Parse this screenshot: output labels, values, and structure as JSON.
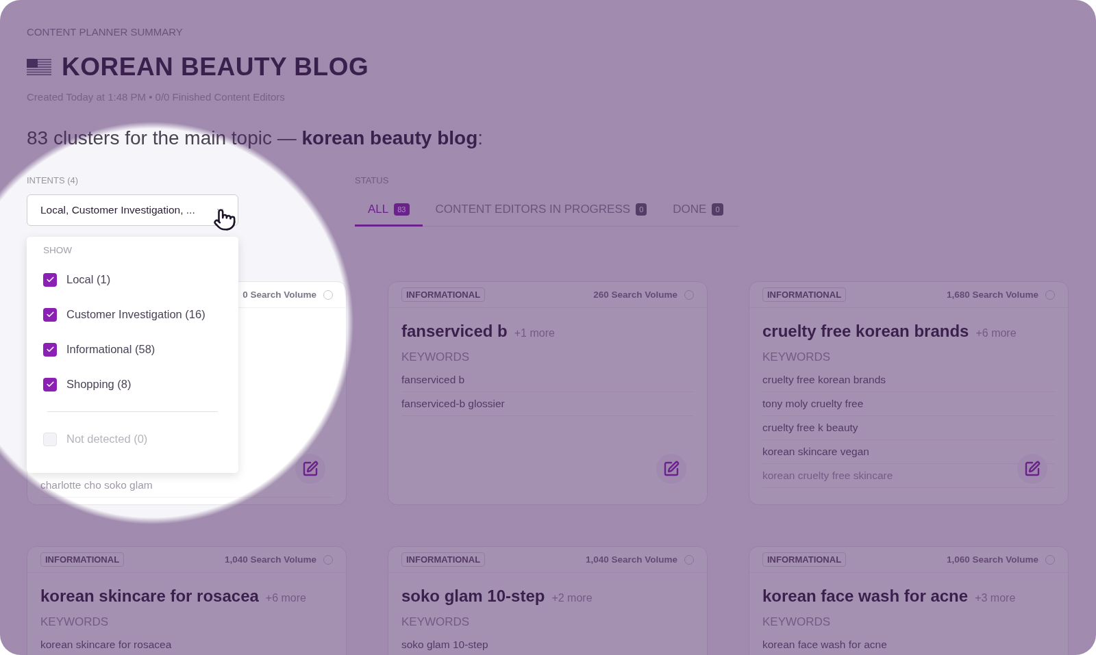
{
  "header": {
    "section_label": "CONTENT PLANNER SUMMARY",
    "title": "KOREAN BEAUTY BLOG",
    "meta": "Created Today at 1:48 PM • 0/0 Finished Content Editors"
  },
  "summary": "83 clusters for the main topic — **korean beauty blog**:",
  "intents": {
    "label": "INTENTS (4)",
    "value": "Local, Customer Investigation, ...",
    "expanded": true,
    "menu": {
      "heading": "SHOW",
      "options": [
        {
          "label": "Local (1)",
          "checked": true,
          "disabled": false
        },
        {
          "label": "Customer Investigation (16)",
          "checked": true,
          "disabled": false
        },
        {
          "label": "Informational (58)",
          "checked": true,
          "disabled": false
        },
        {
          "label": "Shopping (8)",
          "checked": true,
          "disabled": false
        }
      ],
      "extra_options": [
        {
          "label": "Not detected (0)",
          "checked": false,
          "disabled": true
        }
      ]
    }
  },
  "status": {
    "label": "STATUS",
    "tabs": [
      {
        "label": "ALL",
        "count": "83",
        "selected": true
      },
      {
        "label": "CONTENT EDITORS IN PROGRESS",
        "count": "0",
        "selected": false
      },
      {
        "label": "DONE",
        "count": "0",
        "selected": false
      }
    ]
  },
  "clusters": [
    {
      "volume": "0 Search Volume",
      "selected": false,
      "keywords": [
        "charlotte cho soko glam"
      ]
    },
    {
      "tag": "INFORMATIONAL",
      "volume": "260 Search Volume",
      "selected": false,
      "title": "fanserviced b",
      "more": "+1 more",
      "keywords_label": "KEYWORDS",
      "keywords": [
        "fanserviced b",
        "fanserviced-b glossier"
      ]
    },
    {
      "tag": "INFORMATIONAL",
      "volume": "1,680 Search Volume",
      "selected": false,
      "title": "cruelty free korean brands",
      "more": "+6 more",
      "keywords_label": "KEYWORDS",
      "keywords": [
        "cruelty free korean brands",
        "tony moly cruelty free",
        "cruelty free k beauty",
        "korean skincare vegan",
        "korean cruelty free skincare"
      ]
    },
    {
      "tag": "INFORMATIONAL",
      "volume": "1,040 Search Volume",
      "selected": false,
      "title": "korean skincare for rosacea",
      "more": "+6 more",
      "keywords_label": "KEYWORDS",
      "keywords": [
        "korean skincare for rosacea"
      ]
    },
    {
      "tag": "INFORMATIONAL",
      "volume": "1,040 Search Volume",
      "selected": false,
      "title": "soko glam 10-step",
      "more": "+2 more",
      "keywords_label": "KEYWORDS",
      "keywords": [
        "soko glam 10-step"
      ]
    },
    {
      "tag": "INFORMATIONAL",
      "volume": "1,060 Search Volume",
      "selected": false,
      "title": "korean face wash for acne",
      "more": "+3 more",
      "keywords_label": "KEYWORDS",
      "keywords": [
        "korean face wash for acne"
      ]
    }
  ]
}
